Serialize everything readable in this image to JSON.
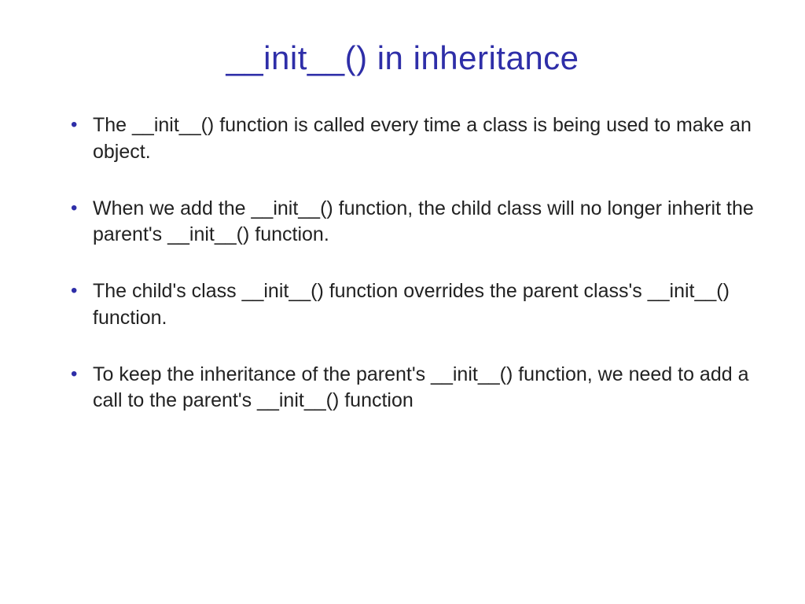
{
  "slide": {
    "title": "__init__() in inheritance",
    "bullets": [
      "The __init__() function is called every time a class is being used to make an object.",
      "When we add the __init__() function, the child class will no longer inherit the parent's __init__() function.",
      "The child's class __init__() function overrides the parent class's __init__() function.",
      "To keep the inheritance of the parent's __init__() function, we need to add a call to the parent's __init__() function"
    ]
  }
}
